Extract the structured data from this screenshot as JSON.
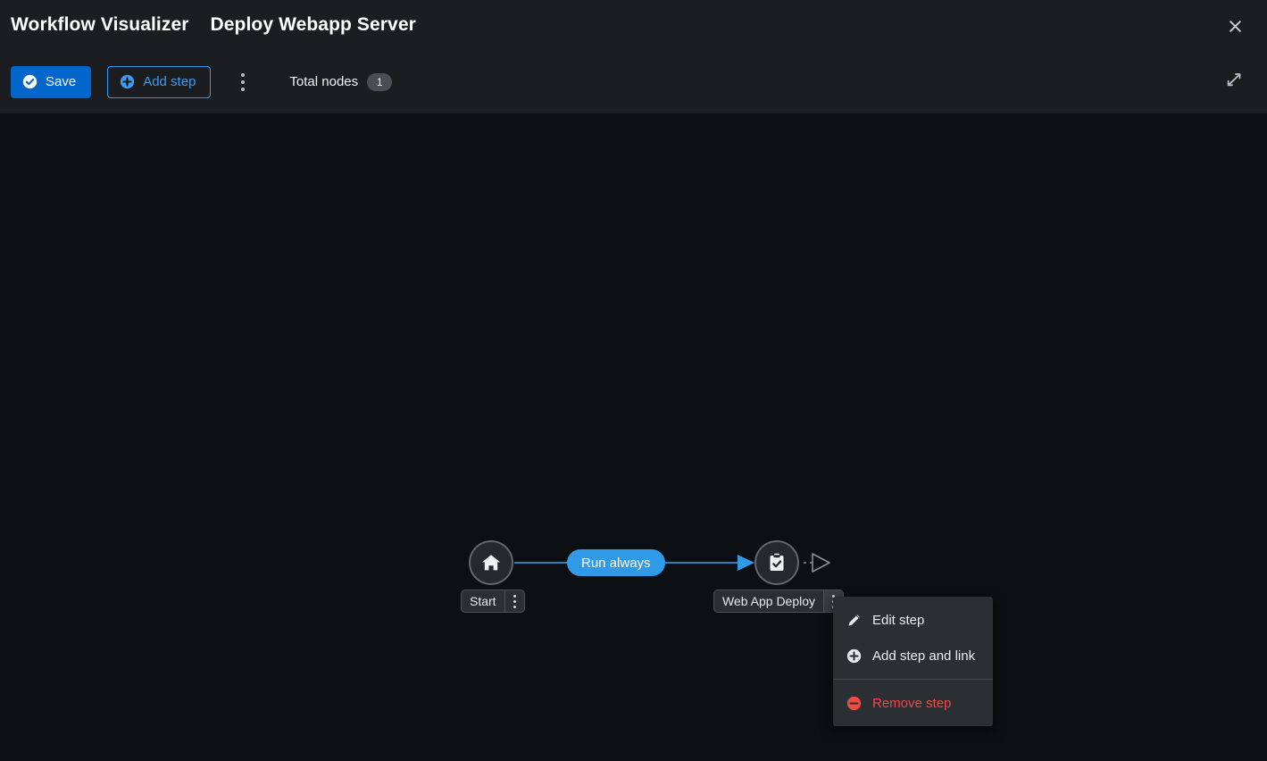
{
  "header": {
    "app_title": "Workflow Visualizer",
    "workflow_title": "Deploy Webapp Server",
    "close_icon": "close-icon",
    "expand_icon": "expand-icon"
  },
  "toolbar": {
    "save_label": "Save",
    "save_icon": "check-circle-icon",
    "add_step_label": "Add step",
    "add_step_icon": "plus-circle-icon",
    "kebab_icon": "kebab-menu-icon",
    "total_nodes_label": "Total nodes",
    "total_nodes_count": "1",
    "accent_blue": "#0066cc",
    "outline_blue": "#2b9af3"
  },
  "graph": {
    "nodes": [
      {
        "id": "start",
        "label": "Start",
        "icon": "home-icon"
      },
      {
        "id": "deploy",
        "label": "Web App Deploy",
        "icon": "clipboard-check-icon"
      }
    ],
    "edges": [
      {
        "from": "start",
        "to": "deploy",
        "label": "Run always",
        "color": "#2f9be8"
      }
    ],
    "placeholder_icon": "add-node-triangle-icon"
  },
  "context_menu": {
    "items": [
      {
        "label": "Edit step",
        "icon": "pencil-icon",
        "danger": false
      },
      {
        "label": "Add step and link",
        "icon": "plus-circle-icon",
        "danger": false
      },
      {
        "label": "Remove step",
        "icon": "minus-circle-icon",
        "danger": true
      }
    ],
    "danger_color": "#f04a45"
  }
}
